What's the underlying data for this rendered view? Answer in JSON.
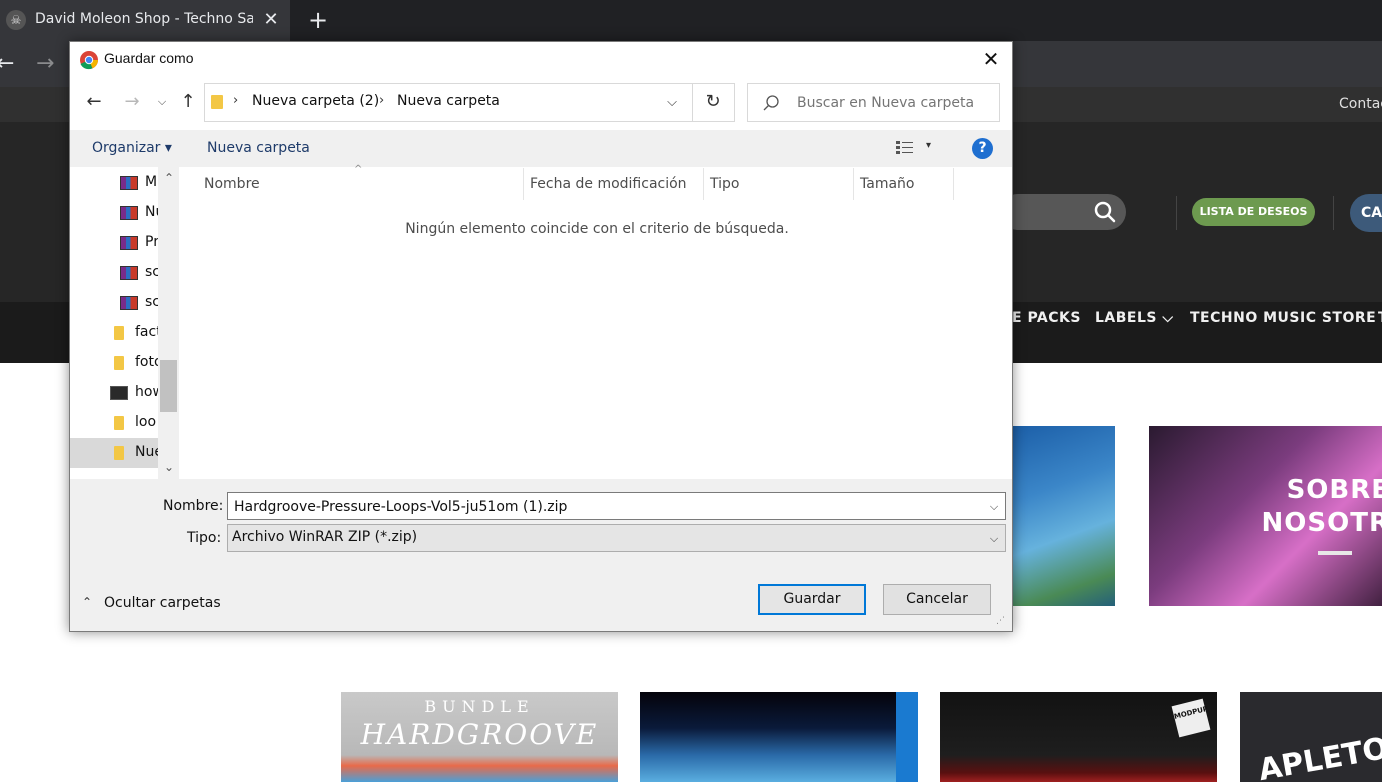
{
  "browser": {
    "tab_title": "David Moleon Shop - Techno San",
    "tab_close": "✕",
    "new_tab": "+",
    "back": "←",
    "forward": "→"
  },
  "website": {
    "contact": "Contac",
    "wishlist": "LISTA DE DESEOS",
    "cart": "CA",
    "nav": [
      "E PACKS",
      "LABELS ⌵",
      "TECHNO MUSIC STORE",
      "T"
    ],
    "promo_text": "SOBRE\nNOSOTR",
    "products": {
      "p1_top": "BUNDLE",
      "p1_title": "HARDGROOVE",
      "p3_logo": "MODPUP",
      "p4_text": "APLETO"
    }
  },
  "dialog": {
    "title": "Guardar como",
    "close": "✕",
    "toolbar": {
      "back": "←",
      "forward": "→",
      "recent": "⌵",
      "up": "↑",
      "breadcrumb": [
        "Nueva carpeta (2)",
        "Nueva carpeta"
      ],
      "separator": "›",
      "dropdown": "⌵",
      "refresh": "↻",
      "search_placeholder": "Buscar en Nueva carpeta"
    },
    "commands": {
      "organize": "Organizar ▾",
      "new_folder": "Nueva carpeta",
      "view_dropdown": "▾",
      "help": "?"
    },
    "nav_pane": {
      "items": [
        {
          "label": "M",
          "icon": "winrar-icon"
        },
        {
          "label": "Nu",
          "icon": "winrar-icon"
        },
        {
          "label": "Pr",
          "icon": "winrar-icon"
        },
        {
          "label": "sc",
          "icon": "winrar-icon"
        },
        {
          "label": "sc",
          "icon": "winrar-icon"
        },
        {
          "label": "fact",
          "icon": "folder-icon"
        },
        {
          "label": "foto",
          "icon": "folder-icon"
        },
        {
          "label": "how",
          "icon": "app-icon"
        },
        {
          "label": "loo",
          "icon": "folder-icon"
        },
        {
          "label": "Nue",
          "icon": "folder-icon"
        }
      ],
      "scroll_up": "⌃",
      "scroll_down": "⌄"
    },
    "columns": [
      "Nombre",
      "Fecha de modificación",
      "Tipo",
      "Tamaño"
    ],
    "sort_arrow": "^",
    "empty_message": "Ningún elemento coincide con el criterio de búsqueda.",
    "filename_label": "Nombre:",
    "filename_value": "Hardgroove-Pressure-Loops-Vol5-ju51om (1).zip",
    "filetype_label": "Tipo:",
    "filetype_value": "Archivo WinRAR ZIP (*.zip)",
    "field_dropdown": "⌵",
    "hide_folders_icon": "⌃",
    "hide_folders": "Ocultar carpetas",
    "save_button": "Guardar",
    "cancel_button": "Cancelar",
    "resize_grip": "⋰"
  }
}
